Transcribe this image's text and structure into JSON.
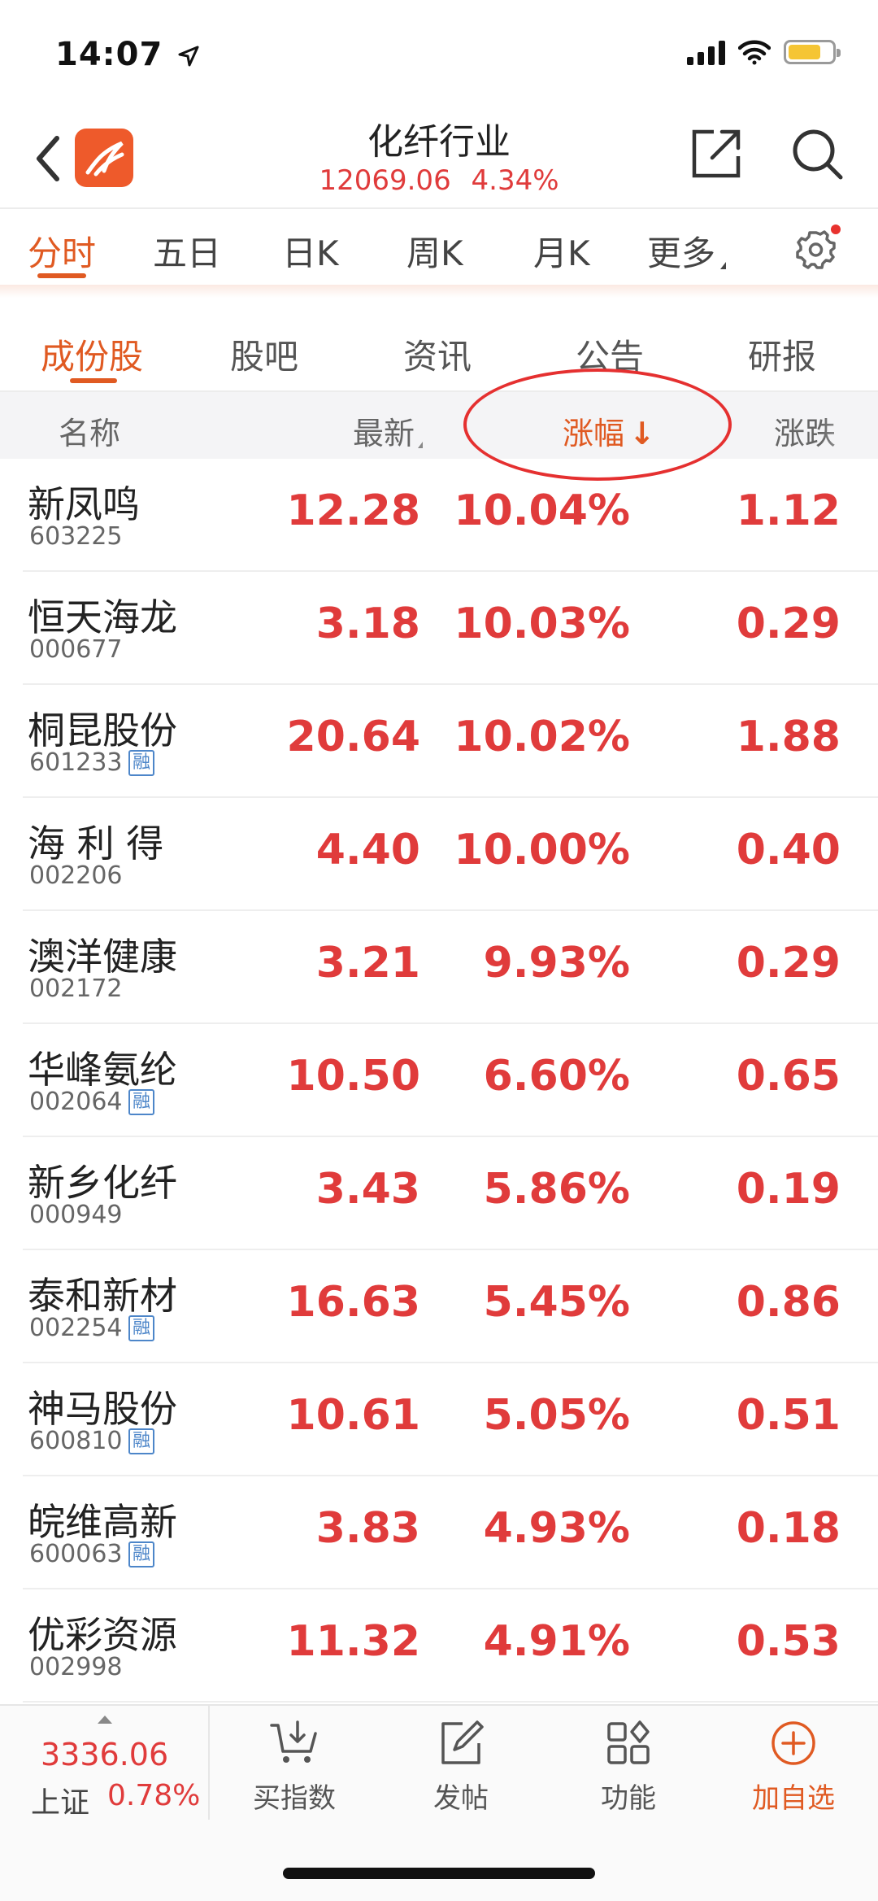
{
  "status_bar": {
    "time": "14:07",
    "icons": [
      "location-arrow-icon",
      "signal-icon",
      "wifi-icon",
      "battery-icon"
    ]
  },
  "header": {
    "title": "化纤行业",
    "index_value": "12069.06",
    "index_change_pct": "4.34%",
    "colors": {
      "accent": "#e05a22",
      "up_red": "#e03b3b",
      "logo_bg": "#ee5a2b"
    }
  },
  "chart_tabs": {
    "items": [
      "分时",
      "五日",
      "日K",
      "周K",
      "月K",
      "更多"
    ],
    "active": "分时"
  },
  "sub_tabs": {
    "items": [
      "成份股",
      "股吧",
      "资讯",
      "公告",
      "研报"
    ],
    "active": "成份股"
  },
  "columns": {
    "name": "名称",
    "latest": "最新",
    "change_pct": "涨幅",
    "change_pct_arrow": "↓",
    "change_amt": "涨跌"
  },
  "stocks": [
    {
      "name": "新凤鸣",
      "code": "603225",
      "rong": false,
      "price": "12.28",
      "pct": "10.04%",
      "chg": "1.12"
    },
    {
      "name": "恒天海龙",
      "code": "000677",
      "rong": false,
      "price": "3.18",
      "pct": "10.03%",
      "chg": "0.29"
    },
    {
      "name": "桐昆股份",
      "code": "601233",
      "rong": true,
      "price": "20.64",
      "pct": "10.02%",
      "chg": "1.88"
    },
    {
      "name": "海 利 得",
      "code": "002206",
      "rong": false,
      "price": "4.40",
      "pct": "10.00%",
      "chg": "0.40"
    },
    {
      "name": "澳洋健康",
      "code": "002172",
      "rong": false,
      "price": "3.21",
      "pct": "9.93%",
      "chg": "0.29"
    },
    {
      "name": "华峰氨纶",
      "code": "002064",
      "rong": true,
      "price": "10.50",
      "pct": "6.60%",
      "chg": "0.65"
    },
    {
      "name": "新乡化纤",
      "code": "000949",
      "rong": false,
      "price": "3.43",
      "pct": "5.86%",
      "chg": "0.19"
    },
    {
      "name": "泰和新材",
      "code": "002254",
      "rong": true,
      "price": "16.63",
      "pct": "5.45%",
      "chg": "0.86"
    },
    {
      "name": "神马股份",
      "code": "600810",
      "rong": true,
      "price": "10.61",
      "pct": "5.05%",
      "chg": "0.51"
    },
    {
      "name": "皖维高新",
      "code": "600063",
      "rong": true,
      "price": "3.83",
      "pct": "4.93%",
      "chg": "0.18"
    },
    {
      "name": "优彩资源",
      "code": "002998",
      "rong": false,
      "price": "11.32",
      "pct": "4.91%",
      "chg": "0.53"
    }
  ],
  "rong_label": "融",
  "bottom_bar": {
    "index_value": "3336.06",
    "index_name": "上证",
    "index_pct": "0.78%",
    "nav": [
      {
        "label": "买指数",
        "icon": "cart-icon"
      },
      {
        "label": "发帖",
        "icon": "compose-icon"
      },
      {
        "label": "功能",
        "icon": "grid-icon"
      },
      {
        "label": "加自选",
        "icon": "add-circle-icon"
      }
    ]
  }
}
